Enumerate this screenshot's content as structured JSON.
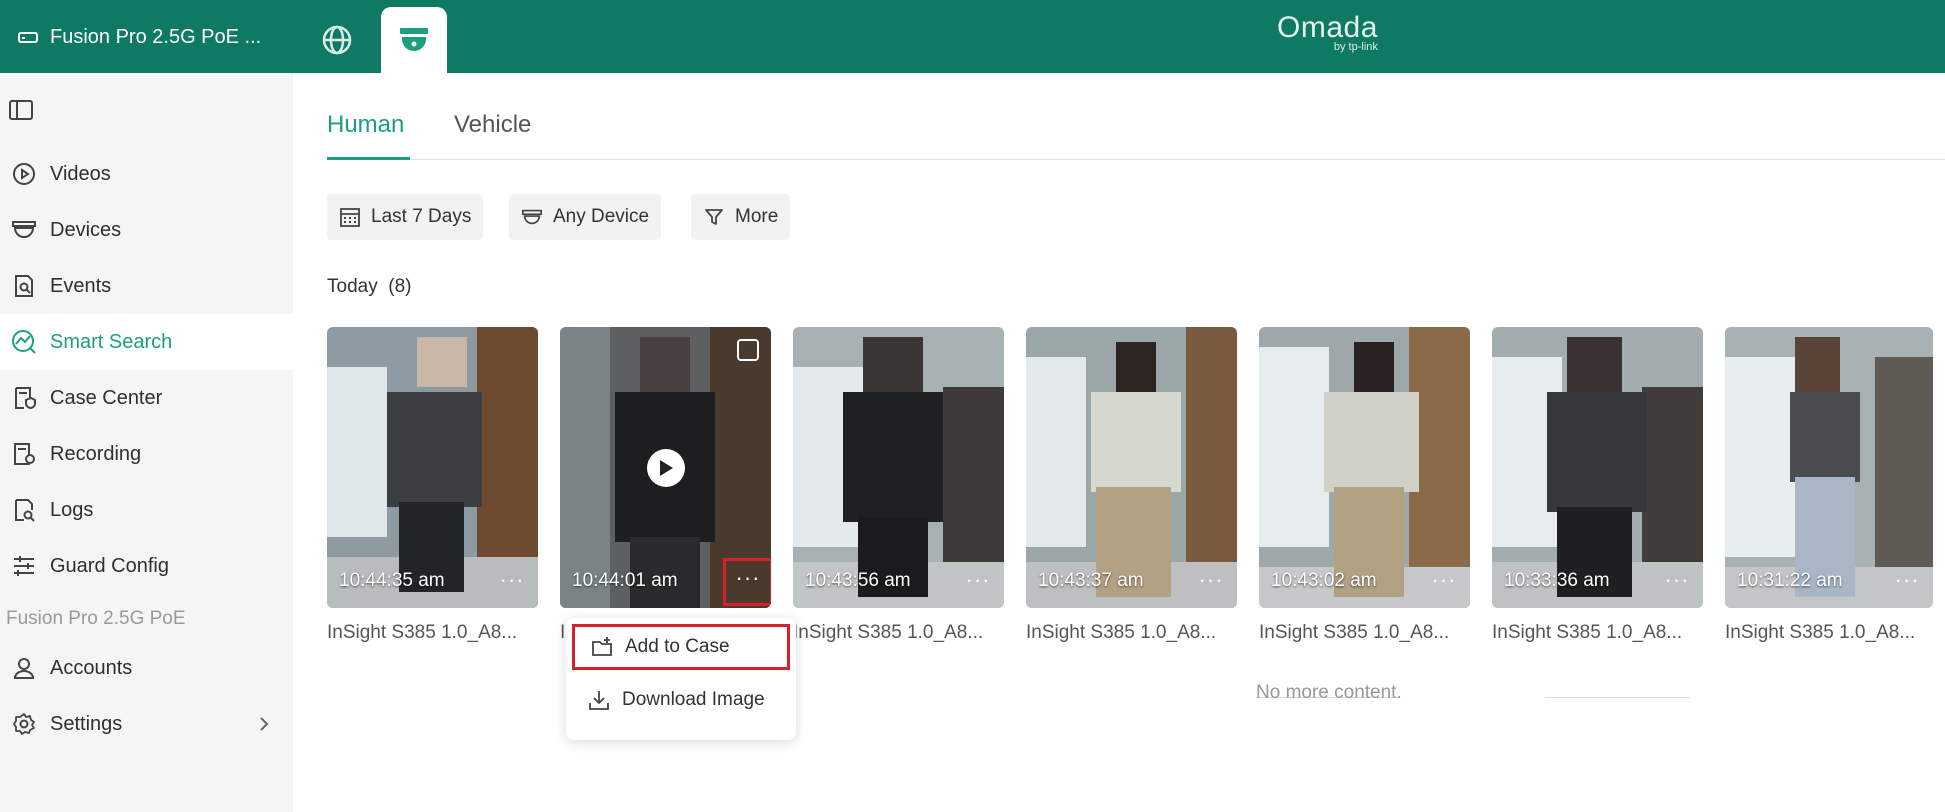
{
  "topbar": {
    "device_name": "Fusion Pro 2.5G PoE ...",
    "logo_main": "Omada",
    "logo_sub": "by tp-link",
    "brand_color": "#0f7a63"
  },
  "sidebar": {
    "items": [
      {
        "label": "Videos",
        "icon": "play-circle-icon"
      },
      {
        "label": "Devices",
        "icon": "camera-dome-icon"
      },
      {
        "label": "Events",
        "icon": "document-search-icon"
      },
      {
        "label": "Smart Search",
        "icon": "smart-search-icon",
        "active": true
      },
      {
        "label": "Case Center",
        "icon": "case-shield-icon"
      },
      {
        "label": "Recording",
        "icon": "recording-settings-icon"
      },
      {
        "label": "Logs",
        "icon": "log-search-icon"
      },
      {
        "label": "Guard Config",
        "icon": "sliders-icon"
      }
    ],
    "group_label": "Fusion Pro 2.5G PoE",
    "group_items": [
      {
        "label": "Accounts",
        "icon": "user-icon"
      },
      {
        "label": "Settings",
        "icon": "gear-icon"
      }
    ]
  },
  "tabs": {
    "human": "Human",
    "vehicle": "Vehicle"
  },
  "filters": {
    "date": "Last 7 Days",
    "device": "Any Device",
    "more": "More"
  },
  "section": {
    "title": "Today",
    "count": "(8)"
  },
  "cards": [
    {
      "time": "10:44:35 am",
      "camera": "InSight S385 1.0_A8..."
    },
    {
      "time": "10:44:01 am",
      "camera": "InSight S385 1.0_A8..."
    },
    {
      "time": "10:43:56 am",
      "camera": "InSight S385 1.0_A8..."
    },
    {
      "time": "10:43:37 am",
      "camera": "InSight S385 1.0_A8..."
    },
    {
      "time": "10:43:02 am",
      "camera": "InSight S385 1.0_A8..."
    },
    {
      "time": "10:33:36 am",
      "camera": "InSight S385 1.0_A8..."
    },
    {
      "time": "10:31:22 am",
      "camera": "InSight S385 1.0_A8..."
    }
  ],
  "card_menu": {
    "add_to_case": "Add to Case",
    "download_image": "Download Image"
  },
  "footer": {
    "no_more": "No more content."
  }
}
